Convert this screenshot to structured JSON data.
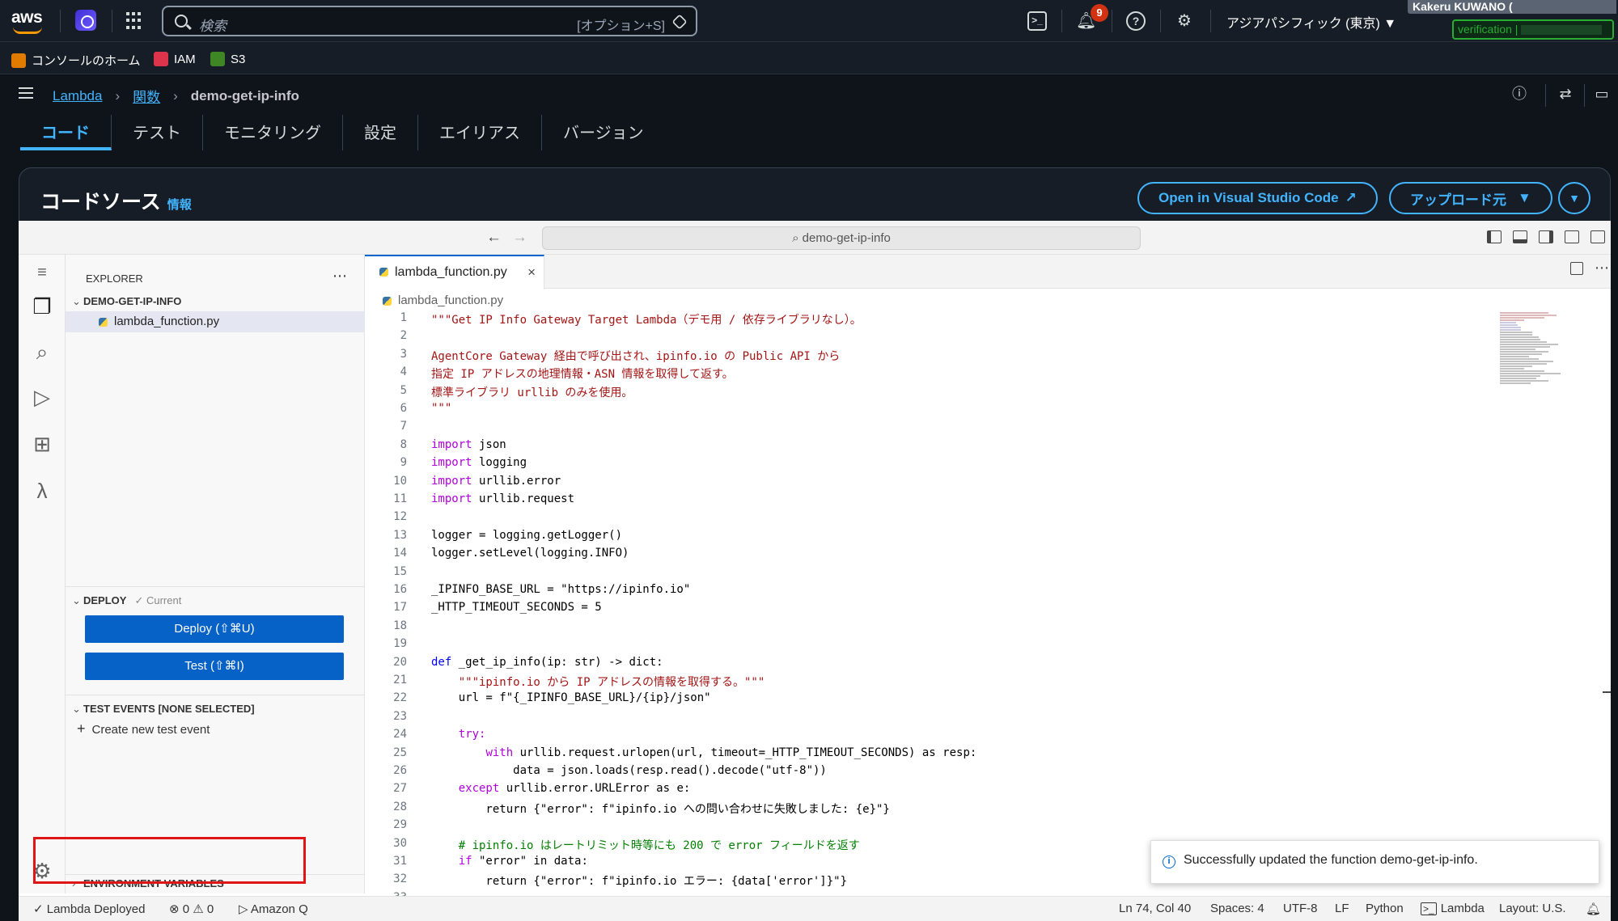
{
  "topbar": {
    "logo": "aws",
    "search_placeholder": "検索",
    "search_shortcut": "[オプション+S]",
    "notification_count": "9",
    "region": "アジアパシフィック (東京) ▼",
    "user": "Kakeru KUWANO (",
    "verification": "verification |"
  },
  "favorites": [
    {
      "label": "コンソールのホーム",
      "color": "#e07b00"
    },
    {
      "label": "IAM",
      "color": "#dd344c"
    },
    {
      "label": "S3",
      "color": "#3f8624"
    }
  ],
  "breadcrumb": {
    "root": "Lambda",
    "mid": "関数",
    "current": "demo-get-ip-info",
    "sep": "›"
  },
  "tabs": [
    "コード",
    "テスト",
    "モニタリング",
    "設定",
    "エイリアス",
    "バージョン"
  ],
  "panel": {
    "title": "コードソース",
    "info": "情報",
    "open_vscode": "Open in Visual Studio Code",
    "upload": "アップロード元"
  },
  "ide": {
    "command_center": "demo-get-ip-info",
    "explorer_title": "EXPLORER",
    "folder": "DEMO-GET-IP-INFO",
    "file": "lambda_function.py",
    "deploy_section": "DEPLOY",
    "deploy_status": "✓ Current",
    "deploy_button": "Deploy (⇧⌘U)",
    "test_button": "Test (⇧⌘I)",
    "test_events": "TEST EVENTS [NONE SELECTED]",
    "create_test": "Create new test event",
    "env_vars": "ENVIRONMENT VARIABLES",
    "editor_tab": "lambda_function.py",
    "editor_breadcrumb": "lambda_function.py"
  },
  "code_lines": [
    "\"\"\"Get IP Info Gateway Target Lambda（デモ用 / 依存ライブラリなし）。",
    "",
    "AgentCore Gateway 経由で呼び出され、ipinfo.io の Public API から",
    "指定 IP アドレスの地理情報・ASN 情報を取得して返す。",
    "標準ライブラリ urllib のみを使用。",
    "\"\"\"",
    "",
    "import json",
    "import logging",
    "import urllib.error",
    "import urllib.request",
    "",
    "logger = logging.getLogger()",
    "logger.setLevel(logging.INFO)",
    "",
    "_IPINFO_BASE_URL = \"https://ipinfo.io\"",
    "_HTTP_TIMEOUT_SECONDS = 5",
    "",
    "",
    "def _get_ip_info(ip: str) -> dict:",
    "    \"\"\"ipinfo.io から IP アドレスの情報を取得する。\"\"\"",
    "    url = f\"{_IPINFO_BASE_URL}/{ip}/json\"",
    "",
    "    try:",
    "        with urllib.request.urlopen(url, timeout=_HTTP_TIMEOUT_SECONDS) as resp:",
    "            data = json.loads(resp.read().decode(\"utf-8\"))",
    "    except urllib.error.URLError as e:",
    "        return {\"error\": f\"ipinfo.io への問い合わせに失敗しました: {e}\"}",
    "",
    "    # ipinfo.io はレートリミット時等にも 200 で error フィールドを返す",
    "    if \"error\" in data:",
    "        return {\"error\": f\"ipinfo.io エラー: {data['error']}\"}",
    ""
  ],
  "toast": "Successfully updated the function demo-get-ip-info.",
  "status": {
    "deployed": "✓ Lambda Deployed",
    "problems": "⊗ 0 ⚠ 0",
    "amazon_q": "▷ Amazon Q",
    "position": "Ln 74, Col 40",
    "spaces": "Spaces: 4",
    "encoding": "UTF-8",
    "eol": "LF",
    "language": "Python",
    "lambda": "Lambda",
    "layout": "Layout: U.S."
  }
}
